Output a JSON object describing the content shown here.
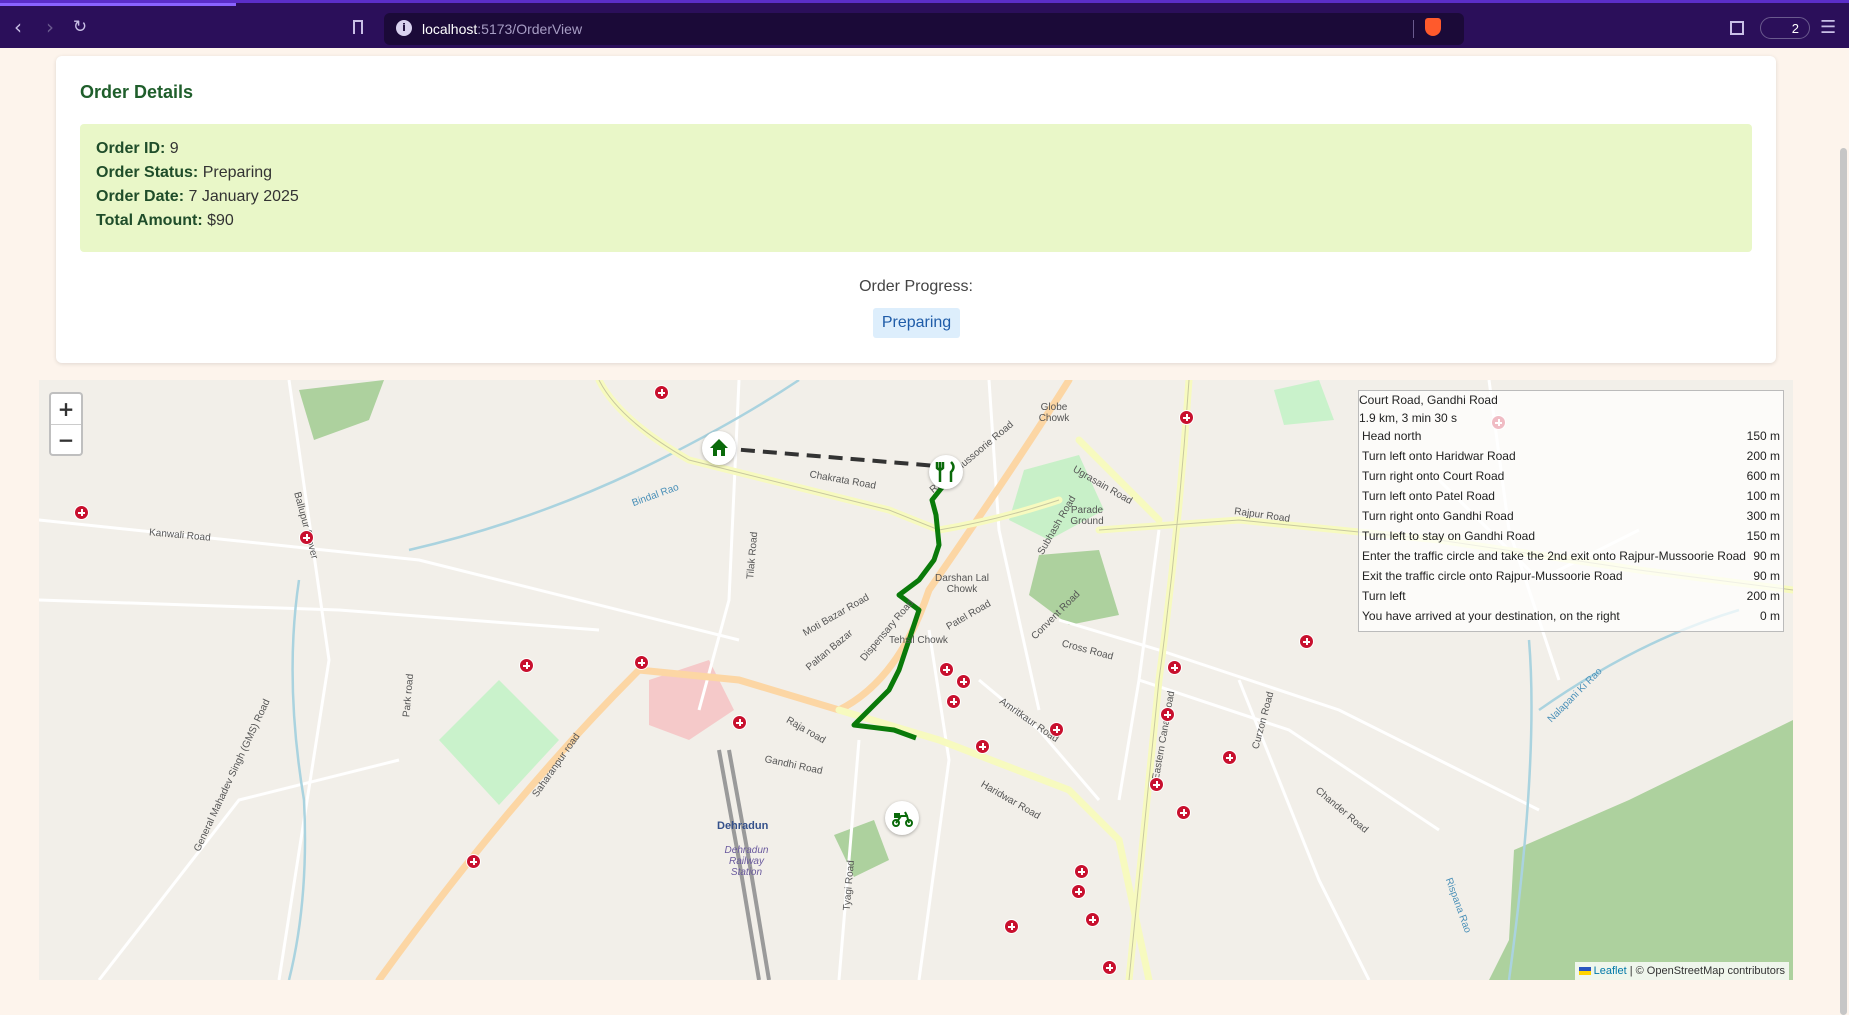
{
  "browser": {
    "url_host": "localhost",
    "url_path": ":5173/OrderView",
    "wallet_count": "2"
  },
  "order": {
    "title": "Order Details",
    "fields": [
      {
        "label": "Order ID:",
        "value": "9"
      },
      {
        "label": "Order Status:",
        "value": "Preparing"
      },
      {
        "label": "Order Date:",
        "value": "7 January 2025"
      },
      {
        "label": "Total Amount:",
        "value": "$90"
      }
    ],
    "progress_label": "Order Progress:",
    "progress_badge": "Preparing"
  },
  "map": {
    "zoom_in": "+",
    "zoom_out": "−",
    "attribution_link": "Leaflet",
    "attribution_text": "| © OpenStreetMap contributors",
    "route": {
      "name": "Court Road, Gandhi Road",
      "summary": "1.9 km, 3 min 30 s",
      "steps": [
        {
          "text": "Head north",
          "dist": "150 m"
        },
        {
          "text": "Turn left onto Haridwar Road",
          "dist": "200 m"
        },
        {
          "text": "Turn right onto Court Road",
          "dist": "600 m"
        },
        {
          "text": "Turn left onto Patel Road",
          "dist": "100 m"
        },
        {
          "text": "Turn right onto Gandhi Road",
          "dist": "300 m"
        },
        {
          "text": "Turn left to stay on Gandhi Road",
          "dist": "150 m"
        },
        {
          "text": "Enter the traffic circle and take the 2nd exit onto Rajpur-Mussoorie Road",
          "dist": "90 m"
        },
        {
          "text": "Exit the traffic circle onto Rajpur-Mussoorie Road",
          "dist": "90 m"
        },
        {
          "text": "Turn left",
          "dist": "200 m"
        },
        {
          "text": "You have arrived at your destination, on the right",
          "dist": "0 m"
        }
      ]
    },
    "labels": [
      "Chakrata Road",
      "Rajpur-Mussoorie Road",
      "Subhash Road",
      "Ugrasain Road",
      "Rajpur Road",
      "Gandhi Road",
      "Haridwar Road",
      "Eastern Canal Road",
      "Saharanpur road",
      "Kanwali Road",
      "Bindal Rao",
      "Parade Ground",
      "Globe Chowk",
      "Darshan Lal Chowk",
      "Tehsil Chowk",
      "Dehradun",
      "Dehradun Railway Station",
      "Patel Road",
      "Convent Road",
      "Cross Road",
      "Amritkaur Road",
      "Curzon Road",
      "Chander Road",
      "Tilak Road",
      "Raja road",
      "Paltan Bazar",
      "Moti Bazar Road",
      "Dispensary Road",
      "Tyagi Road",
      "Park road",
      "General Mahadev Singh (GMS) Road",
      "Ballupur flyover",
      "Rispana Rao",
      "Nalapani Ki Rao"
    ]
  },
  "colors": {
    "route": "#0a7a0a",
    "title_green": "#1f5e2b",
    "details_bg": "#e9f7c8",
    "badge_bg": "#ddeefc",
    "browser_bar": "#2b0f5a"
  },
  "icons": [
    "back-icon",
    "forward-icon",
    "reload-icon",
    "bookmark-icon",
    "info-icon",
    "brave-icon",
    "sidebar-icon",
    "wallet-icon",
    "menu-icon",
    "home-icon",
    "restaurant-icon",
    "scooter-icon",
    "hospital-icon"
  ]
}
